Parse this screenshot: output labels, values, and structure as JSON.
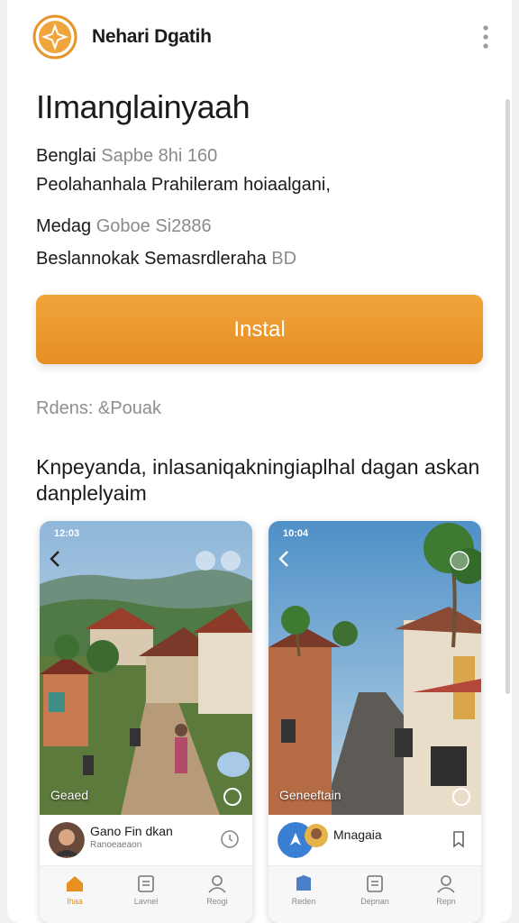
{
  "header": {
    "app_name": "Nehari Dgatih",
    "logo_icon": "compass-star-icon",
    "menu_icon": "more-vertical-icon"
  },
  "title": "IImanglainyaah",
  "details": [
    {
      "label": "Benglai",
      "value": "Sapbe 8hi 160"
    },
    {
      "label": "Peolahanhala Prahileram hoiaalgani,",
      "value": ""
    },
    {
      "label": "Medag",
      "value": "Goboe Si2886"
    },
    {
      "label": "Beslannokak Semasrdleraha",
      "value": "BD"
    }
  ],
  "install_label": "Instal",
  "reviews_label": "Rdens: &Pouak",
  "description": "Knpeyanda, inlasaniqakningiaplhal dagan askan danplelyaim",
  "colors": {
    "accent": "#e88f22",
    "title_text": "#1b1b1b",
    "muted_text": "#8a8a8e"
  },
  "screenshots": [
    {
      "time": "12:03",
      "caption": "Geaed",
      "profile_name": "Gano Fin dkan",
      "profile_sub": "Ranoeaeaon",
      "tabs": [
        "Ihaa",
        "Lavnel",
        "Reogi"
      ]
    },
    {
      "time": "10:04",
      "caption": "Geneeftain",
      "profile_name": "Mnagaia",
      "profile_sub": "",
      "tabs": [
        "Reden",
        "Depnan",
        "Repn"
      ]
    }
  ]
}
